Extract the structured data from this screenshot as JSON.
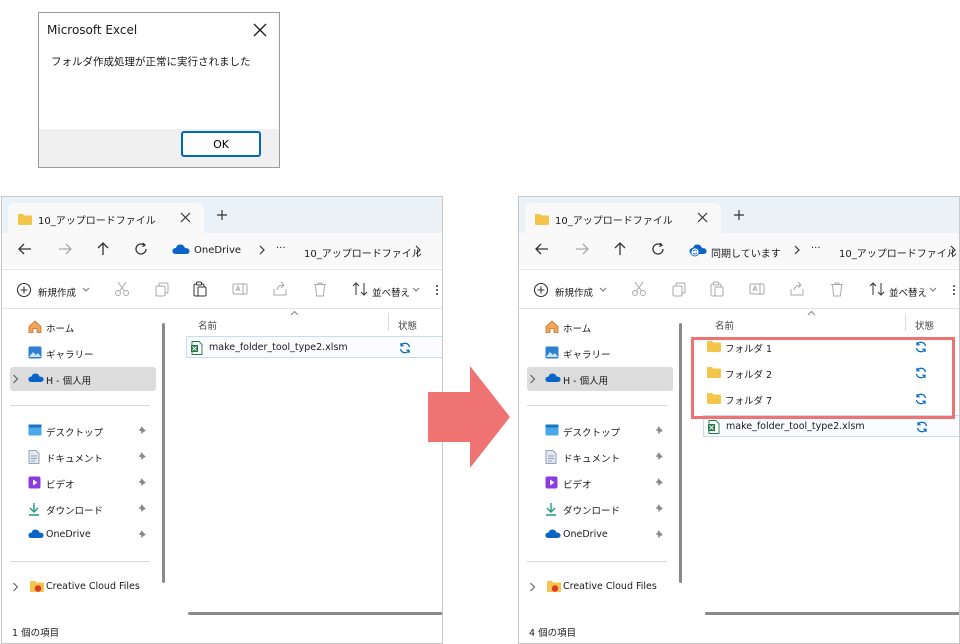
{
  "dialog": {
    "title": "Microsoft Excel",
    "message": "フォルダ作成処理が正常に実行されました",
    "ok_label": "OK"
  },
  "explorer_before": {
    "tab_title": "10_アップロードファイル",
    "breadcrumb_root": "OneDrive",
    "breadcrumb_more": "···",
    "breadcrumb_folder": "10_アップロードファイル",
    "toolbar": {
      "new_label": "新規作成",
      "sort_label": "並べ替え"
    },
    "nav_items": [
      {
        "label": "ホーム"
      },
      {
        "label": "ギャラリー"
      },
      {
        "label": "H - 個人用"
      },
      {
        "label": "デスクトップ"
      },
      {
        "label": "ドキュメント"
      },
      {
        "label": "ビデオ"
      },
      {
        "label": "ダウンロード"
      },
      {
        "label": "OneDrive"
      },
      {
        "label": "Creative Cloud Files"
      }
    ],
    "columns": {
      "name": "名前",
      "status": "状態"
    },
    "files": [
      {
        "name": "make_folder_tool_type2.xlsm",
        "type": "excel"
      }
    ],
    "status": "1 個の項目"
  },
  "explorer_after": {
    "tab_title": "10_アップロードファイル",
    "breadcrumb_root": "同期しています",
    "breadcrumb_more": "···",
    "breadcrumb_folder": "10_アップロードファイル",
    "toolbar": {
      "new_label": "新規作成",
      "sort_label": "並べ替え"
    },
    "nav_items": [
      {
        "label": "ホーム"
      },
      {
        "label": "ギャラリー"
      },
      {
        "label": "H - 個人用"
      },
      {
        "label": "デスクトップ"
      },
      {
        "label": "ドキュメント"
      },
      {
        "label": "ビデオ"
      },
      {
        "label": "ダウンロード"
      },
      {
        "label": "OneDrive"
      },
      {
        "label": "Creative Cloud Files"
      }
    ],
    "columns": {
      "name": "名前",
      "status": "状態"
    },
    "files": [
      {
        "name": "フォルダ 1",
        "type": "folder"
      },
      {
        "name": "フォルダ 2",
        "type": "folder"
      },
      {
        "name": "フォルダ 7",
        "type": "folder"
      },
      {
        "name": "make_folder_tool_type2.xlsm",
        "type": "excel"
      }
    ],
    "status": "4 個の項目"
  },
  "colors": {
    "highlight": "#f07373",
    "arrow": "#f07373",
    "accent": "#0067c0",
    "folder": "#f3c54b",
    "excel": "#1d7a45"
  }
}
